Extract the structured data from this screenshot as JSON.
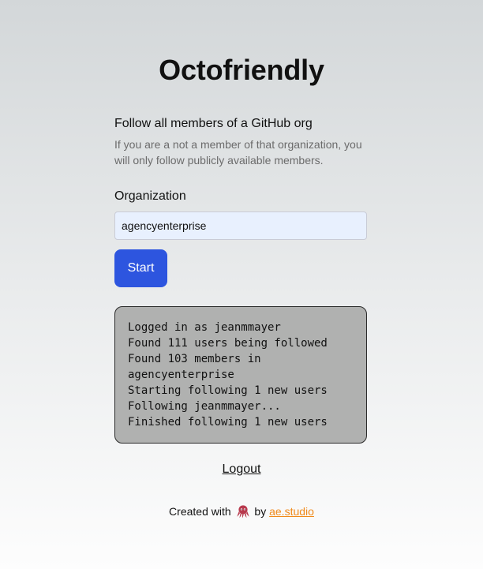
{
  "header": {
    "title": "Octofriendly"
  },
  "intro": {
    "subtitle": "Follow all members of a GitHub org",
    "description": "If you are a not a member of that organization, you will only follow publicly available members."
  },
  "form": {
    "organization_label": "Organization",
    "organization_value": "agencyenterprise",
    "start_label": "Start",
    "input_background": "#e8f0fe",
    "button_color": "#2d55df"
  },
  "log": {
    "lines": [
      "Logged in as jeanmmayer",
      "Found 111 users being followed",
      "Found 103 members in agencyenterprise",
      "Starting following 1 new users",
      "Following jeanmmayer...",
      "Finished following 1 new users"
    ]
  },
  "nav": {
    "logout_label": "Logout"
  },
  "footer": {
    "prefix": "Created with",
    "icon": "octopus-icon",
    "by": "by",
    "link_label": "ae.studio",
    "link_color": "#f08a1a"
  }
}
